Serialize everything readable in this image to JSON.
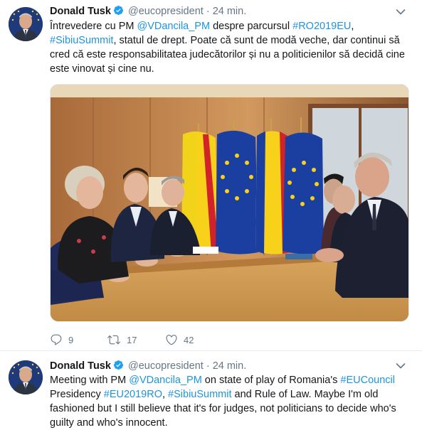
{
  "tweets": [
    {
      "author": "Donald Tusk",
      "handle": "@eucopresident",
      "separator": "·",
      "time": "24 min.",
      "text_parts": [
        {
          "t": "Întrevedere cu PM ",
          "link": false
        },
        {
          "t": "@VDancila_PM",
          "link": true
        },
        {
          "t": " despre parcursul ",
          "link": false
        },
        {
          "t": "#RO2019EU",
          "link": true
        },
        {
          "t": ", ",
          "link": false
        },
        {
          "t": "#SibiuSummit",
          "link": true
        },
        {
          "t": ", statul de drept. Poate că sunt de modă veche, dar continui să cred că este responsabilitatea judecătorilor și nu a politicienilor să decidă cine este vinovat și cine nu.",
          "link": false
        }
      ],
      "replies": "9",
      "retweets": "17",
      "likes": "42"
    },
    {
      "author": "Donald Tusk",
      "handle": "@eucopresident",
      "separator": "·",
      "time": "24 min.",
      "text_parts": [
        {
          "t": "Meeting with PM ",
          "link": false
        },
        {
          "t": "@VDancila_PM",
          "link": true
        },
        {
          "t": " on state of play of Romania's ",
          "link": false
        },
        {
          "t": "#EUCouncil",
          "link": true
        },
        {
          "t": " Presidency ",
          "link": false
        },
        {
          "t": "#EU2019RO",
          "link": true
        },
        {
          "t": ", ",
          "link": false
        },
        {
          "t": "#SibiuSummit",
          "link": true
        },
        {
          "t": " and Rule of Law. Maybe I'm old fashioned but I still believe that it's for judges, not politicians to decide who's guilty and who's innocent.",
          "link": false
        }
      ]
    }
  ],
  "colors": {
    "link": "#1b95e0",
    "muted": "#657786",
    "verified": "#1da1f2"
  },
  "icons": [
    "verified-badge-icon",
    "caret-down-icon",
    "reply-icon",
    "retweet-icon",
    "like-icon"
  ]
}
